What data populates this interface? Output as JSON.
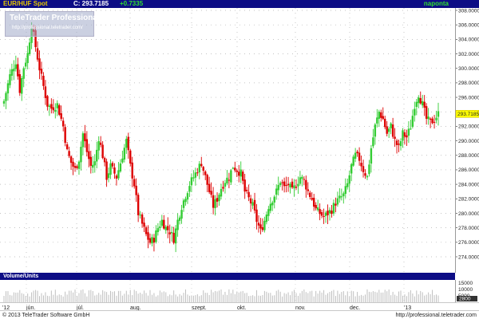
{
  "header": {
    "symbol": "EUR/HUF Spot",
    "last_label": "C: 293.7185",
    "change": "+0.7335",
    "period": "naponta"
  },
  "logo": {
    "name": "TeleTrader Professional",
    "url": "http://professional.teletrader.com/"
  },
  "volume_panel": {
    "title": "Volume/Units",
    "ticks": [
      "15000",
      "10000",
      "5000"
    ],
    "tag": "2800"
  },
  "footer": {
    "copyright": "© 2013 TeleTrader Software GmbH",
    "url": "http://professional.teletrader.com"
  },
  "colors": {
    "up": "#33cc33",
    "down": "#dd0000",
    "volume": "#bfbfbf",
    "title_bg": "#0d0d85",
    "price_tag": "#ffff00"
  },
  "chart_data": {
    "type": "candlestick",
    "instrument": "EUR/HUF Spot",
    "interval": "naponta",
    "last_price": 293.7185,
    "change": 0.7335,
    "price_tag": "293.7185",
    "ylim": [
      272,
      308
    ],
    "y_ticks": [
      "308.0000",
      "306.0000",
      "304.0000",
      "302.0000",
      "300.0000",
      "298.0000",
      "296.0000",
      "294.0000",
      "292.0000",
      "290.0000",
      "288.0000",
      "286.0000",
      "284.0000",
      "282.0000",
      "280.0000",
      "278.0000",
      "276.0000",
      "274.0000"
    ],
    "x_labels": [
      "'12",
      "jún.",
      "júl.",
      "aug.",
      "szept.",
      "okt.",
      "nov.",
      "dec.",
      "'13"
    ],
    "grid": true,
    "close_path": [
      [
        0,
        295.5
      ],
      [
        3,
        299
      ],
      [
        6,
        301
      ],
      [
        8,
        297
      ],
      [
        10,
        300.2
      ],
      [
        12,
        302
      ],
      [
        14,
        306
      ],
      [
        16,
        303
      ],
      [
        18,
        300
      ],
      [
        20,
        297.5
      ],
      [
        22,
        295
      ],
      [
        24,
        294.5
      ],
      [
        27,
        295
      ],
      [
        30,
        292
      ],
      [
        32,
        288.5
      ],
      [
        34,
        287
      ],
      [
        36,
        286
      ],
      [
        38,
        287.5
      ],
      [
        40,
        291
      ],
      [
        42,
        288.5
      ],
      [
        44,
        286.5
      ],
      [
        46,
        287
      ],
      [
        48,
        290.5
      ],
      [
        50,
        288
      ],
      [
        52,
        285
      ],
      [
        54,
        286.5
      ],
      [
        57,
        285
      ],
      [
        60,
        288
      ],
      [
        62,
        290
      ],
      [
        64,
        286.5
      ],
      [
        66,
        284
      ],
      [
        68,
        280
      ],
      [
        70,
        278.5
      ],
      [
        72,
        277
      ],
      [
        74,
        276
      ],
      [
        76,
        276.5
      ],
      [
        78,
        278
      ],
      [
        80,
        279
      ],
      [
        82,
        278
      ],
      [
        84,
        277.5
      ],
      [
        86,
        276.5
      ],
      [
        88,
        279
      ],
      [
        90,
        281
      ],
      [
        92,
        282.5
      ],
      [
        94,
        284
      ],
      [
        96,
        285
      ],
      [
        98,
        286
      ],
      [
        100,
        287
      ],
      [
        102,
        285
      ],
      [
        104,
        283
      ],
      [
        106,
        281
      ],
      [
        108,
        282
      ],
      [
        110,
        283.5
      ],
      [
        112,
        284.5
      ],
      [
        114,
        285
      ],
      [
        116,
        286.5
      ],
      [
        118,
        286
      ],
      [
        120,
        285.5
      ],
      [
        122,
        283
      ],
      [
        124,
        282
      ],
      [
        126,
        281
      ],
      [
        128,
        279
      ],
      [
        130,
        277.5
      ],
      [
        132,
        279
      ],
      [
        134,
        281
      ],
      [
        136,
        282
      ],
      [
        138,
        283
      ],
      [
        140,
        284.5
      ],
      [
        142,
        283.5
      ],
      [
        144,
        284
      ],
      [
        146,
        283
      ],
      [
        148,
        284
      ],
      [
        150,
        285
      ],
      [
        152,
        284.5
      ],
      [
        154,
        283
      ],
      [
        156,
        282
      ],
      [
        158,
        280.5
      ],
      [
        160,
        280
      ],
      [
        162,
        279.5
      ],
      [
        164,
        280
      ],
      [
        166,
        280.5
      ],
      [
        168,
        281.5
      ],
      [
        170,
        282
      ],
      [
        172,
        282.5
      ],
      [
        174,
        284
      ],
      [
        176,
        286.5
      ],
      [
        178,
        288
      ],
      [
        180,
        287.5
      ],
      [
        182,
        286
      ],
      [
        184,
        285
      ],
      [
        186,
        289
      ],
      [
        188,
        292
      ],
      [
        190,
        294
      ],
      [
        192,
        293
      ],
      [
        194,
        291
      ],
      [
        196,
        292
      ],
      [
        198,
        290
      ],
      [
        200,
        289
      ],
      [
        202,
        291
      ],
      [
        204,
        290.5
      ],
      [
        206,
        292
      ],
      [
        208,
        295
      ],
      [
        210,
        296.5
      ],
      [
        212,
        295
      ],
      [
        214,
        293
      ],
      [
        216,
        292.5
      ],
      [
        218,
        293
      ],
      [
        220,
        293.7185
      ]
    ],
    "volume_level": 8000,
    "volume_ylim": [
      0,
      16000
    ]
  }
}
